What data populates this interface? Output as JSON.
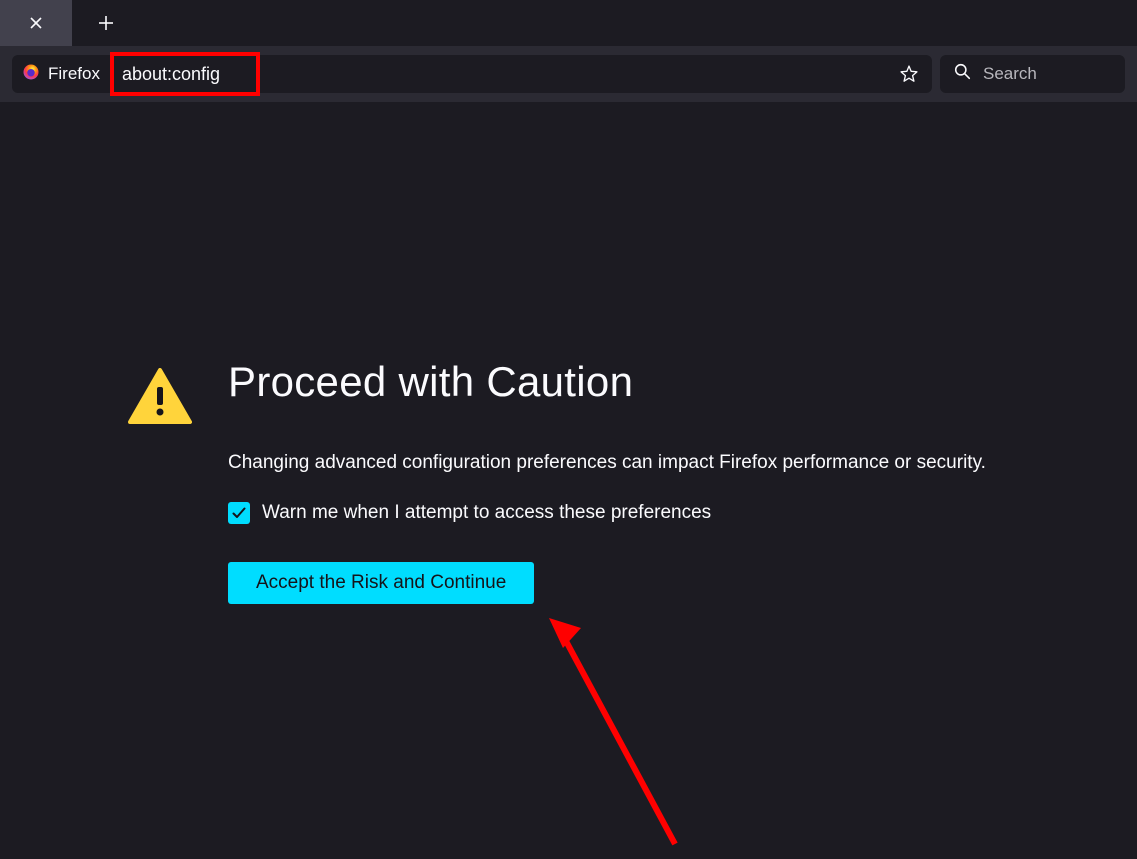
{
  "toolbar": {
    "identity_label": "Firefox",
    "url_value": "about:config",
    "search_placeholder": "Search"
  },
  "warning": {
    "title": "Proceed with Caution",
    "description": "Changing advanced configuration preferences can impact Firefox performance or security.",
    "checkbox_label": "Warn me when I attempt to access these preferences",
    "checkbox_checked": true,
    "button_label": "Accept the Risk and Continue"
  }
}
